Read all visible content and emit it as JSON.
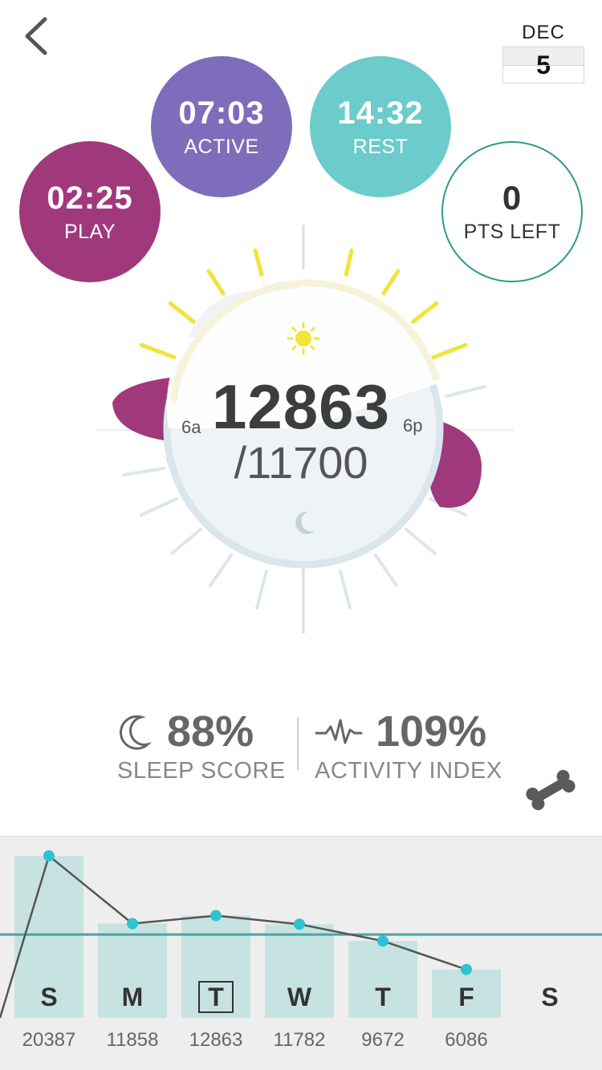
{
  "header": {
    "back_icon": "chevron-left-icon",
    "date_month": "DEC",
    "date_day": "5"
  },
  "bubbles": {
    "play": {
      "time": "02:25",
      "label": "PLAY",
      "color": "#a0397c"
    },
    "active": {
      "time": "07:03",
      "label": "ACTIVE",
      "color": "#7d6dba"
    },
    "rest": {
      "time": "14:32",
      "label": "REST",
      "color": "#6ccbcb"
    },
    "points": {
      "value": "0",
      "label": "PTS LEFT",
      "color": "#2e9a8f"
    }
  },
  "dial": {
    "steps": "12863",
    "goal": "/11700",
    "label_morning": "6a",
    "label_evening": "6p",
    "sun_icon": "sun-icon",
    "moon_icon": "moon-icon"
  },
  "stats": {
    "sleep_value": "88%",
    "sleep_label": "SLEEP SCORE",
    "activity_value": "109%",
    "activity_label": "ACTIVITY INDEX",
    "bone_icon": "bone-icon"
  },
  "history": {
    "days": [
      {
        "letter": "S",
        "steps": "20387",
        "value": 20387
      },
      {
        "letter": "M",
        "steps": "11858",
        "value": 11858
      },
      {
        "letter": "T",
        "steps": "12863",
        "value": 12863,
        "selected": true
      },
      {
        "letter": "W",
        "steps": "11782",
        "value": 11782
      },
      {
        "letter": "T",
        "steps": "9672",
        "value": 9672
      },
      {
        "letter": "F",
        "steps": "6086",
        "value": 6086
      },
      {
        "letter": "S",
        "steps": "",
        "value": null
      }
    ],
    "goal": 11700,
    "bar_color": "#c7e3e1",
    "line_color": "#555555",
    "dot_color": "#2fc3d1",
    "goal_line_color": "#4aa3a0"
  }
}
